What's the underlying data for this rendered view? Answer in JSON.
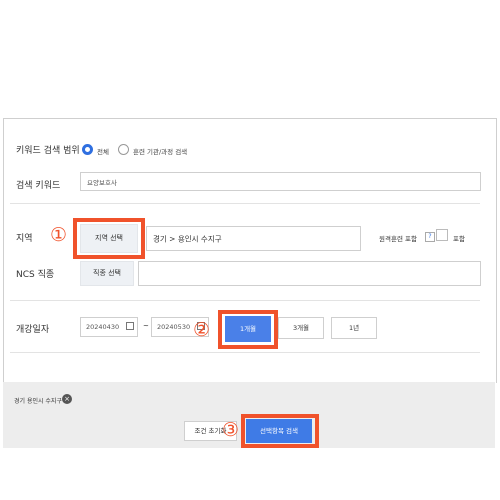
{
  "keyword_scope": {
    "label": "키워드 검색 범위",
    "options": [
      {
        "label": "전체",
        "selected": true
      },
      {
        "label": "훈련 기관/과정 검색",
        "selected": false
      }
    ]
  },
  "keyword": {
    "label": "검색 키워드",
    "value": "요양보호사"
  },
  "region": {
    "label": "지역",
    "button": "지역 선택",
    "value": "경기 > 용인시 수지구",
    "remote_label": "원격훈련 포함",
    "help": "?",
    "include_label": "포함"
  },
  "ncs": {
    "label": "NCS 직종",
    "button": "직종 선택",
    "value": ""
  },
  "opening_date": {
    "label": "개강일자",
    "start": "20240430",
    "separator": "~",
    "end": "20240530",
    "periods": [
      {
        "label": "1개월",
        "selected": true
      },
      {
        "label": "3개월",
        "selected": false
      },
      {
        "label": "1년",
        "selected": false
      }
    ]
  },
  "selected_filter": {
    "text": "경기 용인시 수지구",
    "remove_icon": "×"
  },
  "actions": {
    "reset": "조건 초기화",
    "search": "선택항목 검색"
  },
  "steps": [
    "①",
    "②",
    "③"
  ],
  "colors": {
    "accent": "#2f6fe0",
    "highlight": "#f0522b",
    "button_primary": "#3f7be6"
  }
}
